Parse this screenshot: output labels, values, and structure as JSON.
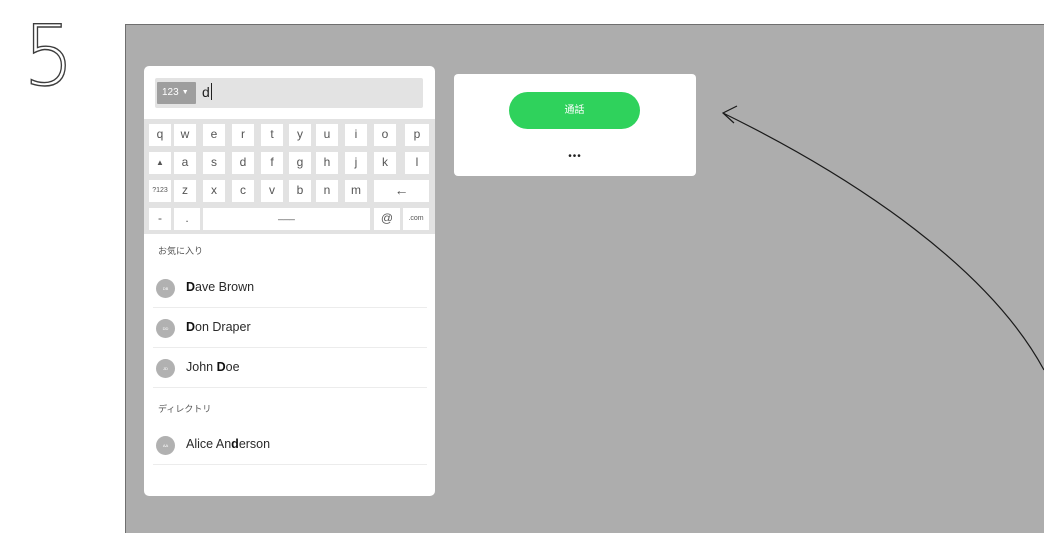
{
  "step": {
    "number": "5"
  },
  "search": {
    "keyboard_toggle": "123",
    "query": "d"
  },
  "keyboard": {
    "row1": [
      "q",
      "w",
      "e",
      "r",
      "t",
      "y",
      "u",
      "i",
      "o",
      "p"
    ],
    "row2": [
      "▲",
      "a",
      "s",
      "d",
      "f",
      "g",
      "h",
      "j",
      "k",
      "l"
    ],
    "row3": [
      "?123",
      "z",
      "x",
      "c",
      "v",
      "b",
      "n",
      "m",
      "←"
    ],
    "row4": [
      "-",
      ".",
      "___",
      "@",
      ".com"
    ]
  },
  "favorites": {
    "label": "お気に入り",
    "items": [
      {
        "initials": "DB",
        "match": "D",
        "rest": "ave Brown"
      },
      {
        "initials": "DD",
        "match": "D",
        "rest": "on Draper"
      },
      {
        "initials": "JD",
        "prefix": "John ",
        "match": "D",
        "rest": "oe"
      }
    ]
  },
  "directory": {
    "label": "ディレクトリ",
    "items": [
      {
        "initials": "AA",
        "prefix": "Alice An",
        "match": "d",
        "rest": "erson"
      }
    ]
  },
  "call_panel": {
    "call_label": "通話",
    "more_label": "•••"
  },
  "colors": {
    "call_green": "#2fd25c",
    "screen_gray": "#adadad"
  }
}
